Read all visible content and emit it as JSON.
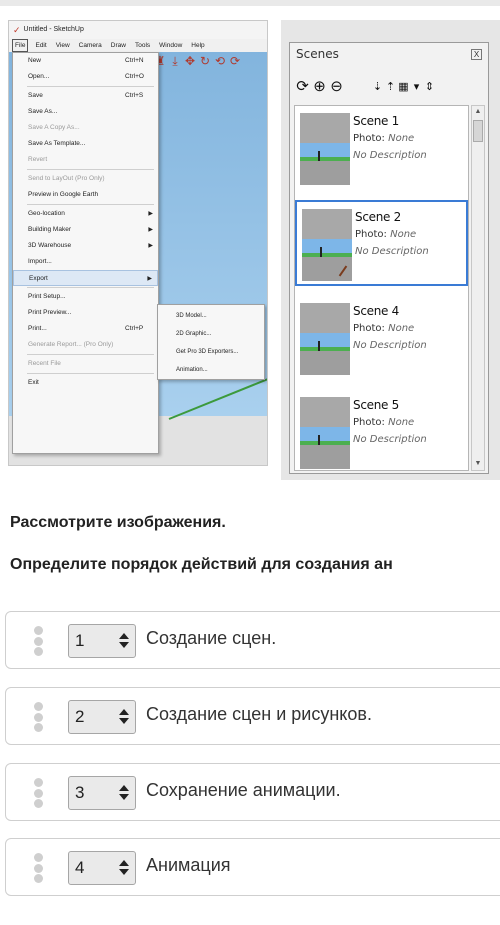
{
  "sketchup": {
    "title": "Untitled - SketchUp",
    "menu": [
      "File",
      "Edit",
      "View",
      "Camera",
      "Draw",
      "Tools",
      "Window",
      "Help"
    ],
    "file_menu": {
      "new": "New",
      "new_short": "Ctrl+N",
      "open": "Open...",
      "open_short": "Ctrl+O",
      "save": "Save",
      "save_short": "Ctrl+S",
      "save_as": "Save As...",
      "save_copy_as": "Save A Copy As...",
      "save_as_template": "Save As Template...",
      "revert": "Revert",
      "send_to_layout": "Send to LayOut (Pro Only)",
      "preview_google_earth": "Preview in Google Earth",
      "geo_location": "Geo-location",
      "building_maker": "Building Maker",
      "warehouse": "3D Warehouse",
      "import": "Import...",
      "export": "Export",
      "print_setup": "Print Setup...",
      "print_preview": "Print Preview...",
      "print": "Print...",
      "print_short": "Ctrl+P",
      "generate_report": "Generate Report... (Pro Only)",
      "recent_file": "Recent File",
      "exit": "Exit"
    },
    "export_submenu": [
      "3D Model...",
      "2D Graphic...",
      "Get Pro 3D Exporters...",
      "Animation..."
    ]
  },
  "scenes_panel": {
    "title": "Scenes",
    "close": "X",
    "photo_label": "Photo:",
    "scenes": [
      {
        "name": "Scene 1",
        "photo": "None",
        "description": "No Description"
      },
      {
        "name": "Scene 2",
        "photo": "None",
        "description": "No Description"
      },
      {
        "name": "Scene 4",
        "photo": "None",
        "description": "No Description"
      },
      {
        "name": "Scene 5",
        "photo": "None",
        "description": "No Description"
      }
    ]
  },
  "question": {
    "line1": "Рассмотрите изображения.",
    "line2": "Определите порядок действий для создания ан"
  },
  "order_items": [
    {
      "position": "1",
      "label": "Создание сцен."
    },
    {
      "position": "2",
      "label": "Создание сцен и рисунков."
    },
    {
      "position": "3",
      "label": "Сохранение анимации."
    },
    {
      "position": "4",
      "label": "Анимация"
    }
  ]
}
